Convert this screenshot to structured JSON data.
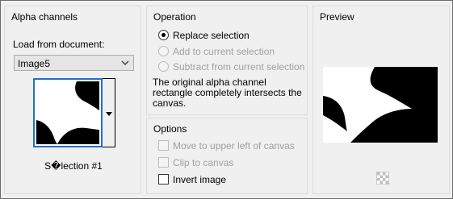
{
  "alpha": {
    "title": "Alpha channels",
    "load_label": "Load from document:",
    "document_select": {
      "value": "Image5"
    },
    "selection_caption": "S�lection #1"
  },
  "operation": {
    "title": "Operation",
    "options": [
      {
        "label": "Replace selection",
        "selected": true,
        "enabled": true
      },
      {
        "label": "Add to current selection",
        "selected": false,
        "enabled": false
      },
      {
        "label": "Subtract from current selection",
        "selected": false,
        "enabled": false
      }
    ],
    "description": "The original alpha channel rectangle completely intersects the canvas."
  },
  "options": {
    "title": "Options",
    "items": [
      {
        "label": "Move to upper left of canvas",
        "checked": false,
        "enabled": false
      },
      {
        "label": "Clip to canvas",
        "checked": false,
        "enabled": false
      },
      {
        "label": "Invert image",
        "checked": false,
        "enabled": true
      }
    ]
  },
  "preview": {
    "title": "Preview"
  },
  "colors": {
    "accent": "#1e6fd9",
    "window_bg": "#f0f0f0",
    "disabled_text": "#a0a0a0"
  }
}
